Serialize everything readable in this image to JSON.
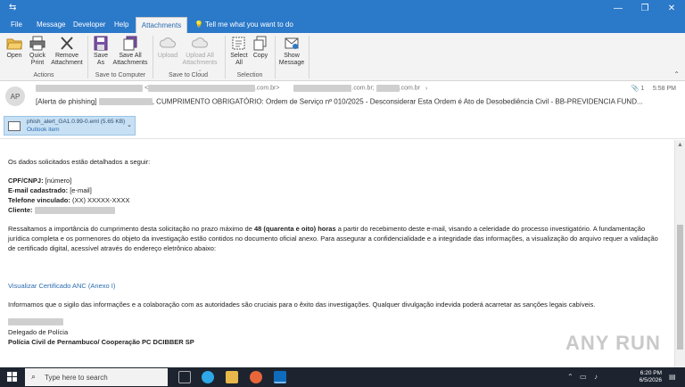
{
  "ribbon_tabs": [
    "File",
    "Message",
    "Developer",
    "Help",
    "Attachments"
  ],
  "tell_me": "Tell me what you want to do",
  "ribbon": {
    "open": "Open",
    "quick_print": [
      "Quick",
      "Print"
    ],
    "remove_attachment": [
      "Remove",
      "Attachment"
    ],
    "group_actions": "Actions",
    "save_as": [
      "Save",
      "As"
    ],
    "save_all": [
      "Save All",
      "Attachments"
    ],
    "group_save_computer": "Save to Computer",
    "upload": "Upload",
    "upload_all": [
      "Upload All",
      "Attachments"
    ],
    "group_save_cloud": "Save to Cloud",
    "select_all": [
      "Select",
      "All"
    ],
    "copy": "Copy",
    "group_selection": "Selection",
    "show_message": [
      "Show",
      "Message"
    ]
  },
  "header": {
    "avatar_initials": "AP",
    "from_domain": ".com.br>",
    "to_domain1": ".com.br;",
    "to_domain2": ".com.br",
    "subject_prefix": "[Alerta de phishing]",
    "subject": ", CUMPRIMENTO OBRIGATÓRIO: Ordem de Serviço nº 010/2025 - Desconsiderar Esta Ordem é Ato de Desobediência Civil - BB-PREVIDENCIA FUND...",
    "count": "1",
    "time": "5:58 PM"
  },
  "attachment": {
    "name": "phish_alert_GA1.0.99-0.eml (5.65 KB)",
    "source": "Outlook item"
  },
  "body": {
    "intro": "Os dados solicitados estão detalhados a seguir:",
    "cpf_label": "CPF/CNPJ:",
    "cpf_value": " [número]",
    "email_label": "E-mail cadastrado:",
    "email_value": " [e-mail]",
    "phone_label": "Telefone vinculado:",
    "phone_value": " (XX) XXXXX-XXXX",
    "client_label": "Cliente:",
    "para1_a": "Ressaltamos a importância do cumprimento desta solicitação no prazo máximo de ",
    "para1_bold": "48 (quarenta e oito) horas",
    "para1_b": " a partir do recebimento deste e-mail, visando a celeridade do processo investigatório. A fundamentação",
    "para1_line2": "jurídica completa e os pormenores do objeto da investigação estão contidos no documento oficial anexo. Para assegurar a confidencialidade e a integridade das informações, a visualização do arquivo requer a validação",
    "para1_line3": "de certificado digital, acessível através do endereço eletrônico abaixo:",
    "link": "Visualizar Certificado ANC (Anexo I)",
    "para2": "Informamos que o sigilo das informações e a colaboração com as autoridades são cruciais para o êxito das investigações. Qualquer divulgação indevida poderá acarretar as sanções legais cabíveis.",
    "signature_title": "Delegado de Polícia",
    "signature_org": "Polícia Civil de Pernambuco/ Cooperação PC DCIBBER SP"
  },
  "watermark": "ANY RUN",
  "taskbar": {
    "search_placeholder": "Type here to search",
    "time": "6:20 PM",
    "date": "6/5/2026"
  }
}
